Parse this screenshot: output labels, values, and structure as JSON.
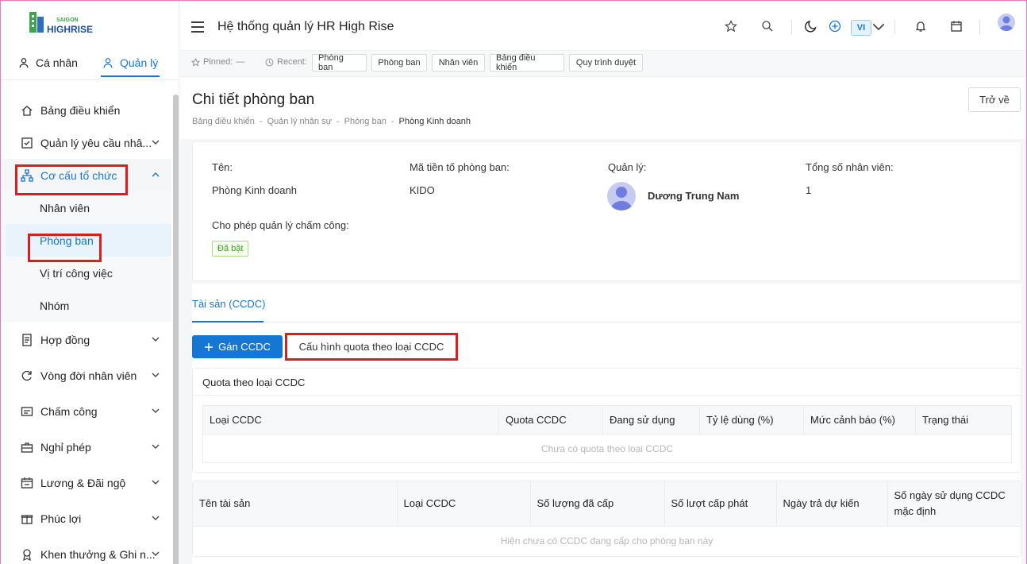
{
  "brand": {
    "logo_top": "SAIGON",
    "logo_bottom": "HIGHRISE"
  },
  "sidebar": {
    "mode_tabs": [
      "Cá nhân",
      "Quản lý"
    ],
    "items": [
      {
        "label": "Bảng điều khiển",
        "icon": "home-icon"
      },
      {
        "label": "Quản lý yêu cầu nhâ...",
        "icon": "checkbox-icon"
      },
      {
        "label": "Cơ cấu tổ chức",
        "icon": "org-chart-icon"
      },
      {
        "label": "Hợp đồng",
        "icon": "contract-icon"
      },
      {
        "label": "Vòng đời nhân viên",
        "icon": "refresh-icon"
      },
      {
        "label": "Chấm công",
        "icon": "timesheet-icon"
      },
      {
        "label": "Nghỉ phép",
        "icon": "suitcase-icon"
      },
      {
        "label": "Lương & Đãi ngộ",
        "icon": "calendar-money-icon"
      },
      {
        "label": "Phúc lợi",
        "icon": "gift-icon"
      },
      {
        "label": "Khen thưởng & Ghi n...",
        "icon": "award-icon"
      }
    ],
    "sub_items": [
      "Nhân viên",
      "Phòng ban",
      "Vị trí công việc",
      "Nhóm"
    ]
  },
  "header": {
    "title": "Hệ thống quản lý HR High Rise",
    "lang": "VI"
  },
  "recent_bar": {
    "pinned_label": "Pinned:",
    "pinned_value": "—",
    "recent_label": "Recent:",
    "chips": [
      "Phòng ban",
      "Phòng ban",
      "Nhân viên",
      "Bảng điều khiển",
      "Quy trình duyệt"
    ]
  },
  "page": {
    "title": "Chi tiết phòng ban",
    "breadcrumb": [
      "Bảng điều khiển",
      "-",
      "Quản lý nhân sự",
      "-",
      "Phòng ban",
      "-",
      "Phòng Kinh doanh"
    ],
    "back_label": "Trở về"
  },
  "info": {
    "name_label": "Tên:",
    "name_value": "Phòng Kinh doanh",
    "prefix_label": "Mã tiền tố phòng ban:",
    "prefix_value": "KIDO",
    "manager_label": "Quản lý:",
    "manager_value": "Dương Trung Nam",
    "total_label": "Tổng số nhân viên:",
    "total_value": "1",
    "attendance_label": "Cho phép quản lý chấm công:",
    "attendance_badge": "Đã bật"
  },
  "assets": {
    "tab_label": "Tài sản (CCDC)",
    "assign_button": "Gán CCDC",
    "quota_button": "Cấu hình quota theo loại CCDC",
    "quota_title": "Quota theo loại CCDC",
    "quota_columns": [
      "Loại CCDC",
      "Quota CCDC",
      "Đang sử dụng",
      "Tỷ lệ dùng (%)",
      "Mức cảnh báo (%)",
      "Trạng thái"
    ],
    "quota_empty": "Chưa có quota theo loại CCDC",
    "asset_columns": [
      "Tên tài sản",
      "Loại CCDC",
      "Số lượng đã cấp",
      "Số lượt cấp phát",
      "Ngày trả dự kiến",
      "Số ngày sử dụng CCDC mặc định"
    ],
    "asset_empty": "Hiện chưa có CCDC đang cấp cho phòng ban này"
  },
  "colors": {
    "accent": "#1677d3",
    "highlight_box": "#e01b1b",
    "badge_green": "#3a9c1e"
  }
}
